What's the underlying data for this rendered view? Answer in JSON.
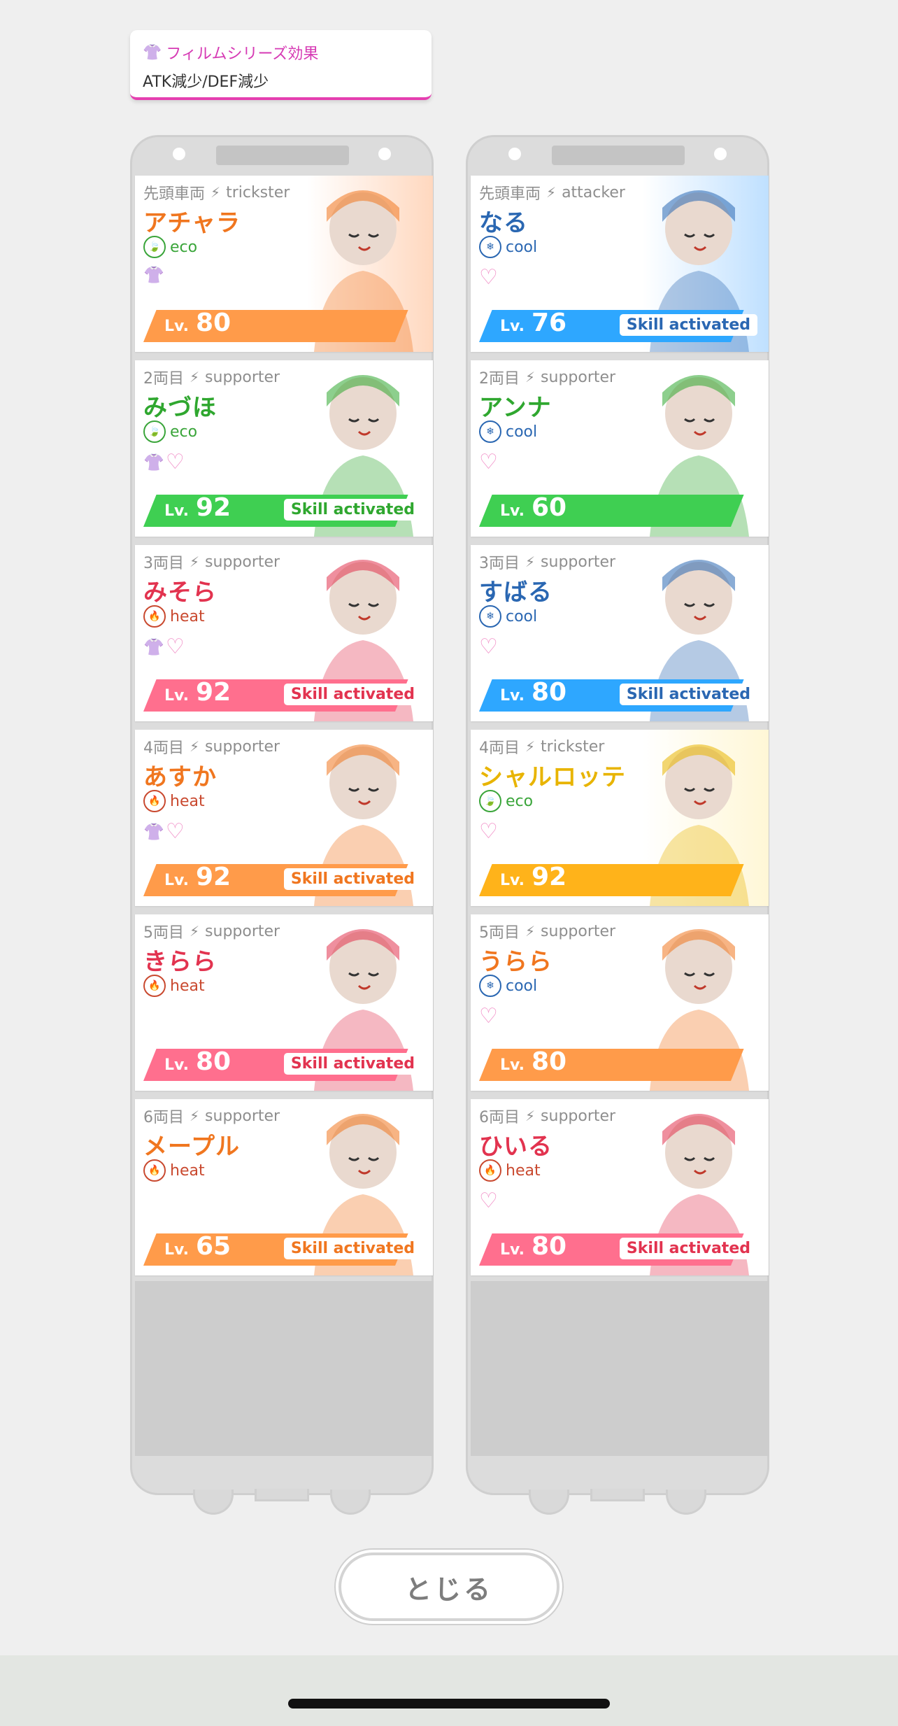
{
  "series_effect": {
    "title": "フィルムシリーズ効果",
    "description": "ATK減少/DEF減少"
  },
  "colors": {
    "eco": "#3aa53a",
    "cool": "#2a67b2",
    "heat": "#c9492f",
    "band_orange": "#ff9b4a",
    "band_blue": "#2ea7ff",
    "band_green": "#3fcf52",
    "band_pink": "#ff6f8e",
    "band_yellow": "#ffb31a"
  },
  "left_train": [
    {
      "position": "先頭車両",
      "role": "trickster",
      "name": "アチャラ",
      "name_color": "#f0761f",
      "attribute": "eco",
      "films": [
        "shirt"
      ],
      "lv_label": "Lv.",
      "level": "80",
      "band": "#ff9b4a",
      "skill": "",
      "accent": "#ffd8bf"
    },
    {
      "position": "2両目",
      "role": "supporter",
      "name": "みづほ",
      "name_color": "#2fa72f",
      "attribute": "eco",
      "films": [
        "shirt",
        "heart"
      ],
      "lv_label": "Lv.",
      "level": "92",
      "band": "#3fcf52",
      "skill": "Skill activated",
      "skill_color": "#2fa72f",
      "accent": "#ffffff"
    },
    {
      "position": "3両目",
      "role": "supporter",
      "name": "みそら",
      "name_color": "#e2334f",
      "attribute": "heat",
      "films": [
        "shirt",
        "heart"
      ],
      "lv_label": "Lv.",
      "level": "92",
      "band": "#ff6f8e",
      "skill": "Skill activated",
      "skill_color": "#e2334f",
      "accent": "#ffffff"
    },
    {
      "position": "4両目",
      "role": "supporter",
      "name": "あすか",
      "name_color": "#f0761f",
      "attribute": "heat",
      "films": [
        "shirt",
        "heart"
      ],
      "lv_label": "Lv.",
      "level": "92",
      "band": "#ff9b4a",
      "skill": "Skill activated",
      "skill_color": "#f0761f",
      "accent": "#ffffff"
    },
    {
      "position": "5両目",
      "role": "supporter",
      "name": "きらら",
      "name_color": "#e2334f",
      "attribute": "heat",
      "films": [],
      "lv_label": "Lv.",
      "level": "80",
      "band": "#ff6f8e",
      "skill": "Skill activated",
      "skill_color": "#e2334f",
      "accent": "#ffffff"
    },
    {
      "position": "6両目",
      "role": "supporter",
      "name": "メープル",
      "name_color": "#f0761f",
      "attribute": "heat",
      "films": [],
      "lv_label": "Lv.",
      "level": "65",
      "band": "#ff9b4a",
      "skill": "Skill activated",
      "skill_color": "#f0761f",
      "accent": "#ffffff"
    }
  ],
  "right_train": [
    {
      "position": "先頭車両",
      "role": "attacker",
      "name": "なる",
      "name_color": "#2a67b2",
      "attribute": "cool",
      "films": [
        "heart"
      ],
      "lv_label": "Lv.",
      "level": "76",
      "band": "#2ea7ff",
      "skill": "Skill activated",
      "skill_color": "#2a67b2",
      "accent": "#bfe0ff"
    },
    {
      "position": "2両目",
      "role": "supporter",
      "name": "アンナ",
      "name_color": "#2fa72f",
      "attribute": "cool",
      "films": [
        "heart"
      ],
      "lv_label": "Lv.",
      "level": "60",
      "band": "#3fcf52",
      "skill": "",
      "accent": "#ffffff"
    },
    {
      "position": "3両目",
      "role": "supporter",
      "name": "すばる",
      "name_color": "#2a67b2",
      "attribute": "cool",
      "films": [
        "heart"
      ],
      "lv_label": "Lv.",
      "level": "80",
      "band": "#2ea7ff",
      "skill": "Skill activated",
      "skill_color": "#2a67b2",
      "accent": "#ffffff"
    },
    {
      "position": "4両目",
      "role": "trickster",
      "name": "シャルロッテ",
      "name_color": "#e8b400",
      "attribute": "eco",
      "films": [
        "heart"
      ],
      "lv_label": "Lv.",
      "level": "92",
      "band": "#ffb31a",
      "skill": "",
      "accent": "#fff7d6"
    },
    {
      "position": "5両目",
      "role": "supporter",
      "name": "うらら",
      "name_color": "#f0761f",
      "attribute": "cool",
      "films": [
        "heart"
      ],
      "lv_label": "Lv.",
      "level": "80",
      "band": "#ff9b4a",
      "skill": "",
      "accent": "#ffffff"
    },
    {
      "position": "6両目",
      "role": "supporter",
      "name": "ひいる",
      "name_color": "#e2334f",
      "attribute": "heat",
      "films": [
        "heart"
      ],
      "lv_label": "Lv.",
      "level": "80",
      "band": "#ff6f8e",
      "skill": "Skill activated",
      "skill_color": "#e2334f",
      "accent": "#ffffff"
    }
  ],
  "close_button": {
    "label": "とじる"
  }
}
